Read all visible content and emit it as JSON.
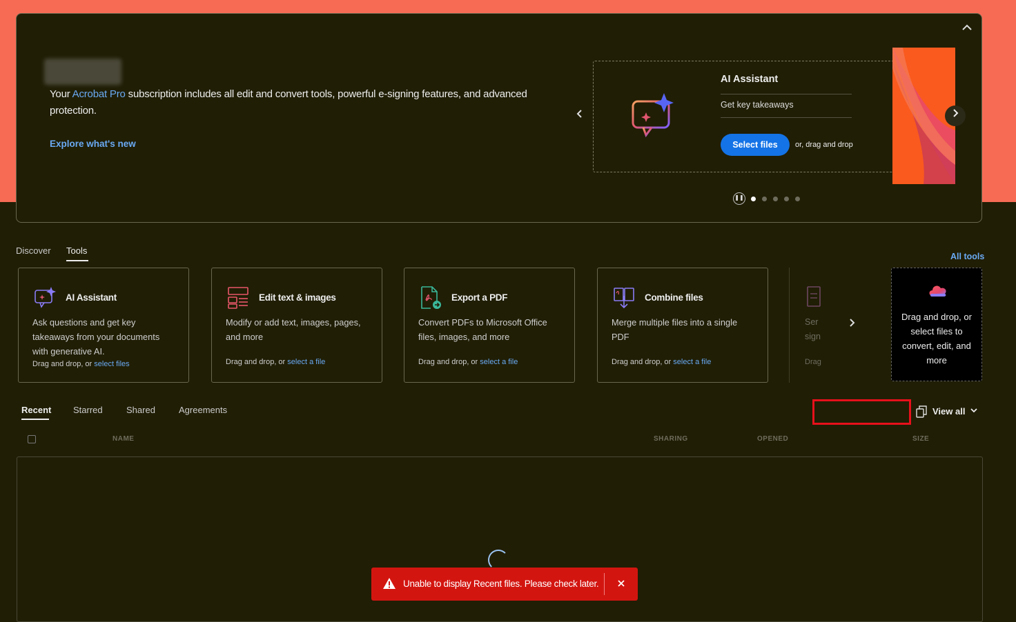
{
  "hero": {
    "promo_prefix": "Your ",
    "promo_accent": "Acrobat Pro",
    "promo_suffix": " subscription includes all edit and convert tools, powerful e-signing features, and advanced protection.",
    "explore_link": "Explore what's new",
    "collapse_icon": "chevron-up-icon",
    "carousel": {
      "card_title": "AI Assistant",
      "card_subtitle": "Get key takeaways",
      "select_button": "Select files",
      "drag_note": "or, drag and drop",
      "prev_icon": "chevron-left-icon",
      "next_icon": "chevron-right-icon",
      "slide_count": 5,
      "active_slide": 1
    }
  },
  "tabs": {
    "discover": "Discover",
    "tools": "Tools",
    "active": "Tools",
    "all_tools_link": "All tools"
  },
  "tools": [
    {
      "title": "AI Assistant",
      "description": "Ask questions and get key takeaways from your documents with generative AI.",
      "drag_prefix": "Drag and drop, or ",
      "drag_link": "select files",
      "icon": "ai-assistant-icon"
    },
    {
      "title": "Edit text & images",
      "description": "Modify or add text, images, pages, and more",
      "drag_prefix": "Drag and drop, or ",
      "drag_link": "select a file",
      "icon": "edit-pdf-icon"
    },
    {
      "title": "Export a PDF",
      "description": "Convert PDFs to Microsoft Office files, images, and more",
      "drag_prefix": "Drag and drop, or ",
      "drag_link": "select a file",
      "icon": "export-pdf-icon"
    },
    {
      "title": "Combine files",
      "description": "Merge multiple files into a single PDF",
      "drag_prefix": "Drag and drop, or ",
      "drag_link": "select a file",
      "icon": "combine-files-icon"
    }
  ],
  "partial_tool": {
    "line1": "Ser",
    "line2": "sign",
    "line3": "Drag"
  },
  "drop_tile": {
    "text": "Drag and drop, or select files to convert, edit, and more",
    "icon": "cloud-upload-icon"
  },
  "recent_tabs": {
    "recent": "Recent",
    "starred": "Starred",
    "shared": "Shared",
    "agreements": "Agreements",
    "active": "Recent"
  },
  "view_all": {
    "label": "View all",
    "icon": "copy-icon"
  },
  "columns": {
    "name": "NAME",
    "sharing": "SHARING",
    "opened": "OPENED",
    "size": "SIZE"
  },
  "toast": {
    "message": "Unable to display Recent files. Please check later.",
    "close_icon": "close-icon",
    "warning_icon": "warning-icon"
  },
  "colors": {
    "background": "#201e05",
    "top_band": "#f76b55",
    "accent_blue": "#1473e6",
    "link_blue": "#6aaaf4",
    "error_red": "#d31510",
    "highlight_red": "#e8101b"
  }
}
